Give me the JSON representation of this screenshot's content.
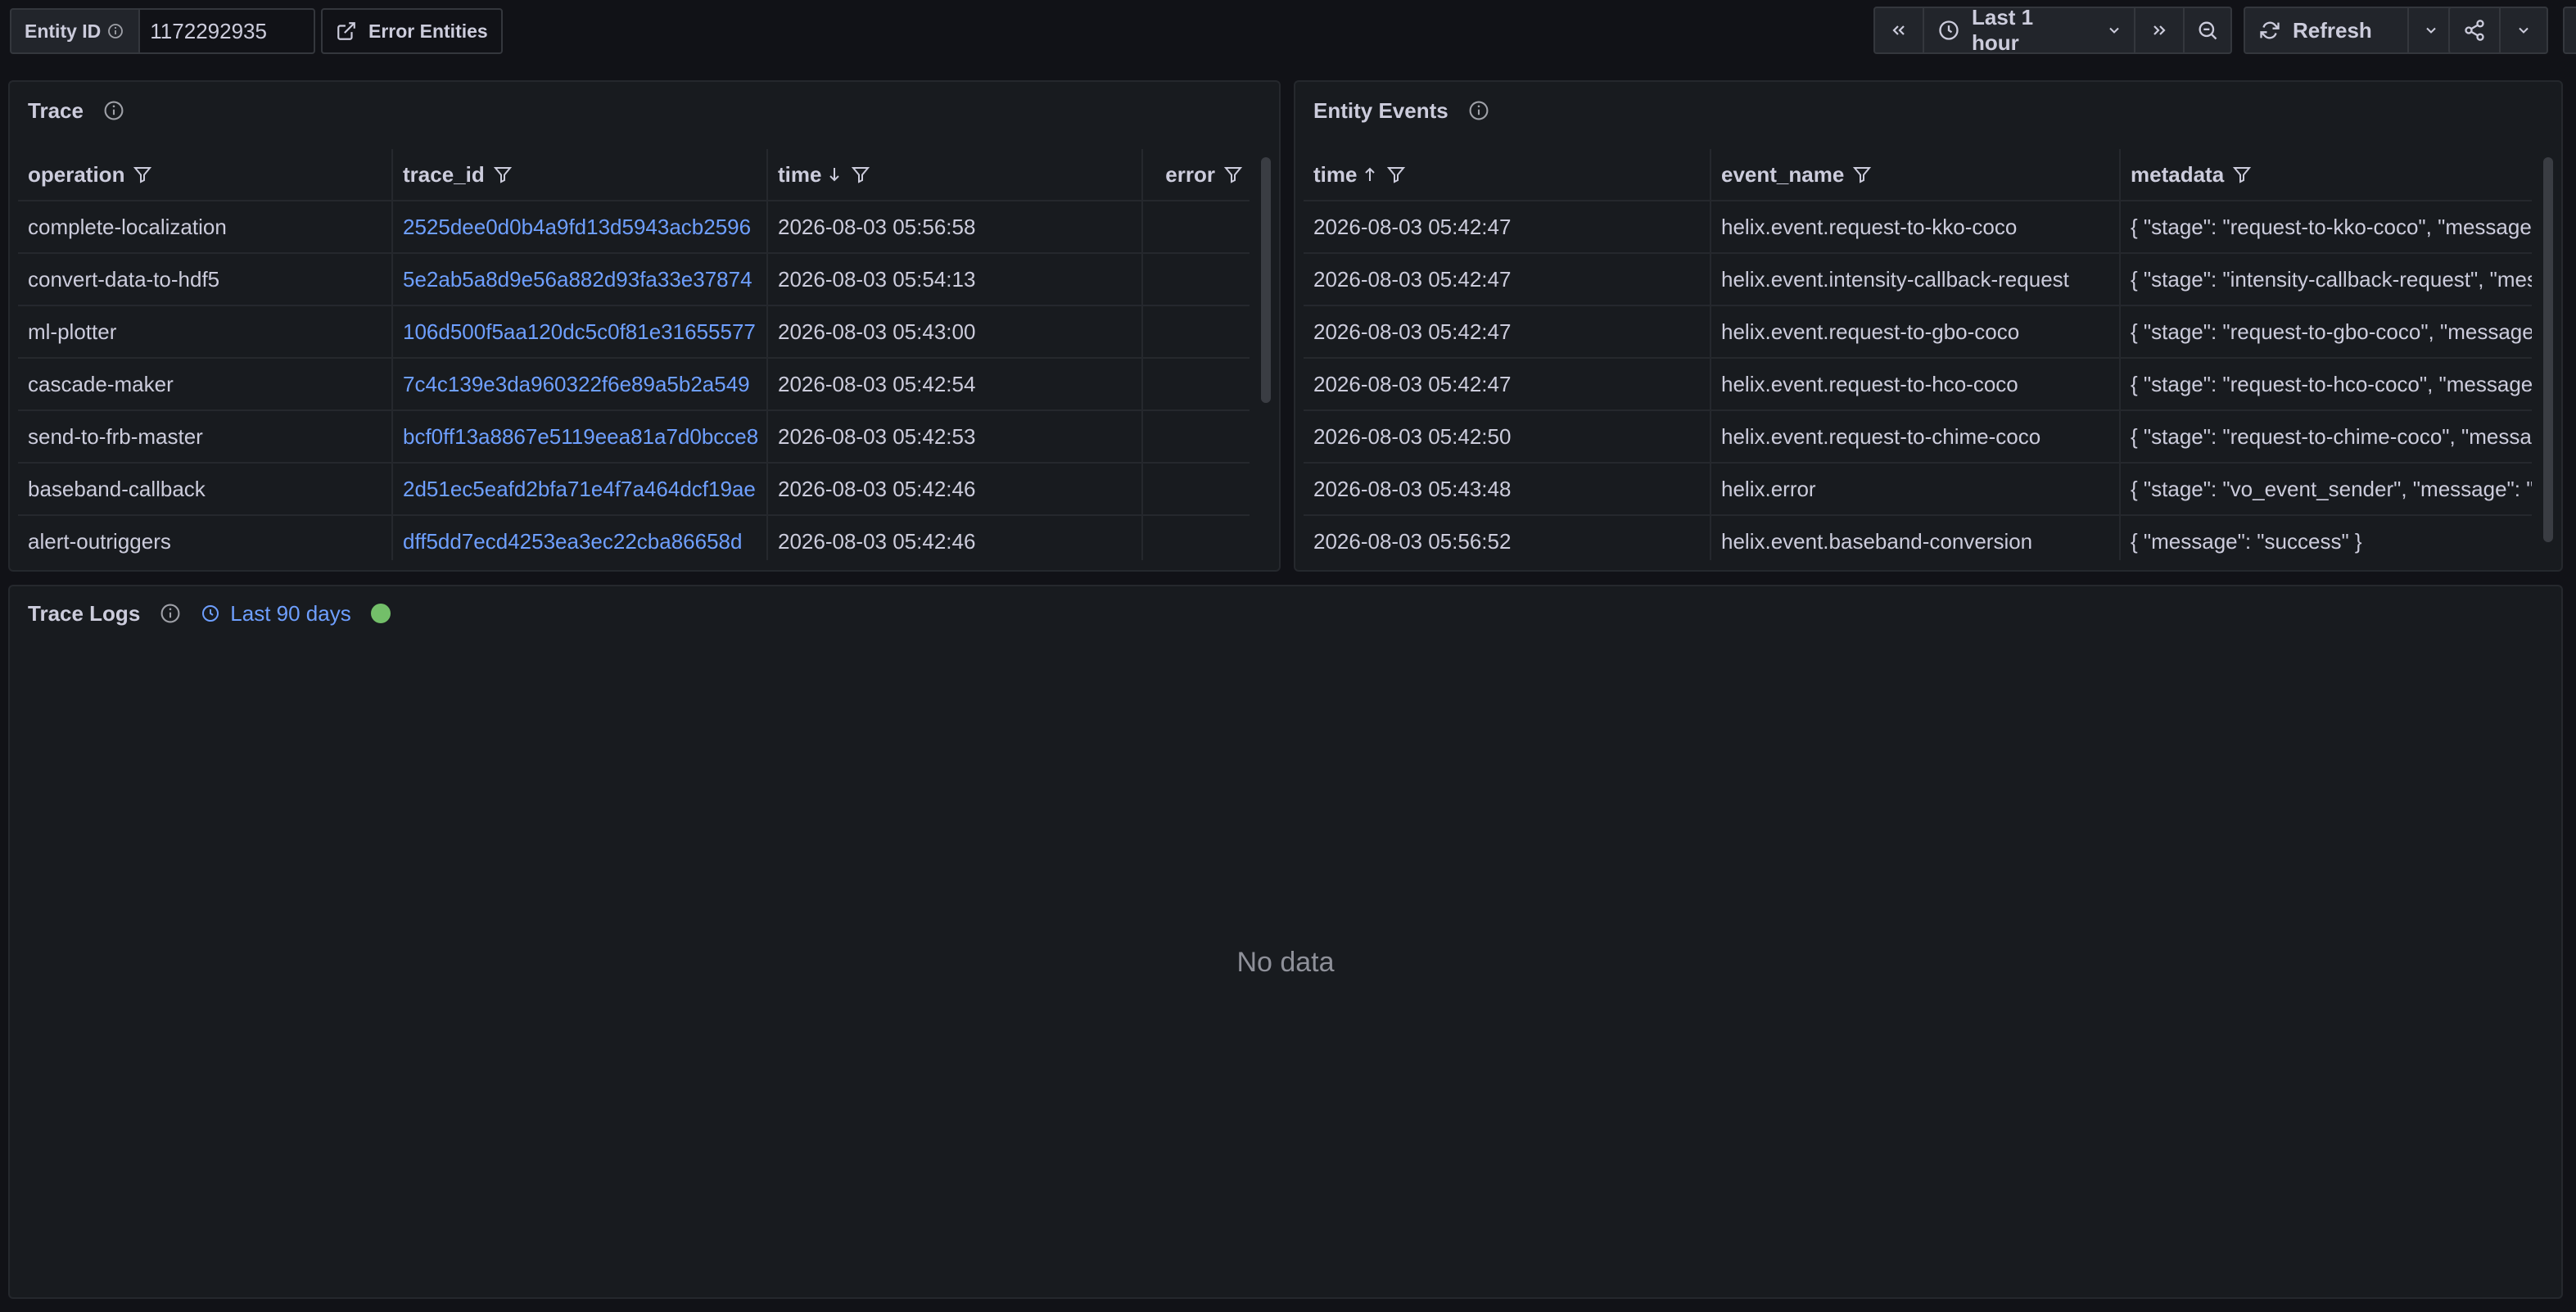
{
  "variables": {
    "entity_id_label": "Entity ID",
    "entity_id_value": "1172292935",
    "error_entities_label": "Error Entities"
  },
  "toolbar": {
    "time_range": "Last 1 hour",
    "refresh_label": "Refresh"
  },
  "trace": {
    "title": "Trace",
    "columns": [
      "operation",
      "trace_id",
      "time",
      "error"
    ],
    "rows": [
      {
        "operation": "complete-localization",
        "trace_id": "2525dee0d0b4a9fd13d5943acb2596",
        "time": "2026-08-03 05:56:58",
        "error": ""
      },
      {
        "operation": "convert-data-to-hdf5",
        "trace_id": "5e2ab5a8d9e56a882d93fa33e37874",
        "time": "2026-08-03 05:54:13",
        "error": ""
      },
      {
        "operation": "ml-plotter",
        "trace_id": "106d500f5aa120dc5c0f81e31655577",
        "time": "2026-08-03 05:43:00",
        "error": ""
      },
      {
        "operation": "cascade-maker",
        "trace_id": "7c4c139e3da960322f6e89a5b2a549",
        "time": "2026-08-03 05:42:54",
        "error": ""
      },
      {
        "operation": "send-to-frb-master",
        "trace_id": "bcf0ff13a8867e5119eea81a7d0bcce8",
        "time": "2026-08-03 05:42:53",
        "error": ""
      },
      {
        "operation": "baseband-callback",
        "trace_id": "2d51ec5eafd2bfa71e4f7a464dcf19ae",
        "time": "2026-08-03 05:42:46",
        "error": ""
      },
      {
        "operation": "alert-outriggers",
        "trace_id": "dff5dd7ecd4253ea3ec22cba86658d",
        "time": "2026-08-03 05:42:46",
        "error": ""
      }
    ]
  },
  "entity_events": {
    "title": "Entity Events",
    "columns": [
      "time",
      "event_name",
      "metadata"
    ],
    "rows": [
      {
        "time": "2026-08-03 05:42:47",
        "event_name": "helix.event.request-to-kko-coco",
        "metadata": "{ \"stage\": \"request-to-kko-coco\", \"message\": \"success\" }"
      },
      {
        "time": "2026-08-03 05:42:47",
        "event_name": "helix.event.intensity-callback-request",
        "metadata": "{ \"stage\": \"intensity-callback-request\", \"message\": \"success\" }"
      },
      {
        "time": "2026-08-03 05:42:47",
        "event_name": "helix.event.request-to-gbo-coco",
        "metadata": "{ \"stage\": \"request-to-gbo-coco\", \"message\": \"success\" }"
      },
      {
        "time": "2026-08-03 05:42:47",
        "event_name": "helix.event.request-to-hco-coco",
        "metadata": "{ \"stage\": \"request-to-hco-coco\", \"message\": \"success\" }"
      },
      {
        "time": "2026-08-03 05:42:50",
        "event_name": "helix.event.request-to-chime-coco",
        "metadata": "{ \"stage\": \"request-to-chime-coco\", \"message\": \"success\" }"
      },
      {
        "time": "2026-08-03 05:43:48",
        "event_name": "helix.error",
        "metadata": "{ \"stage\": \"vo_event_sender\", \"message\": \"error\" }"
      },
      {
        "time": "2026-08-03 05:56:52",
        "event_name": "helix.event.baseband-conversion",
        "metadata": "{ \"message\": \"success\" }"
      }
    ]
  },
  "trace_logs": {
    "title": "Trace Logs",
    "time_override": "Last 90 days",
    "empty_text": "No data"
  }
}
